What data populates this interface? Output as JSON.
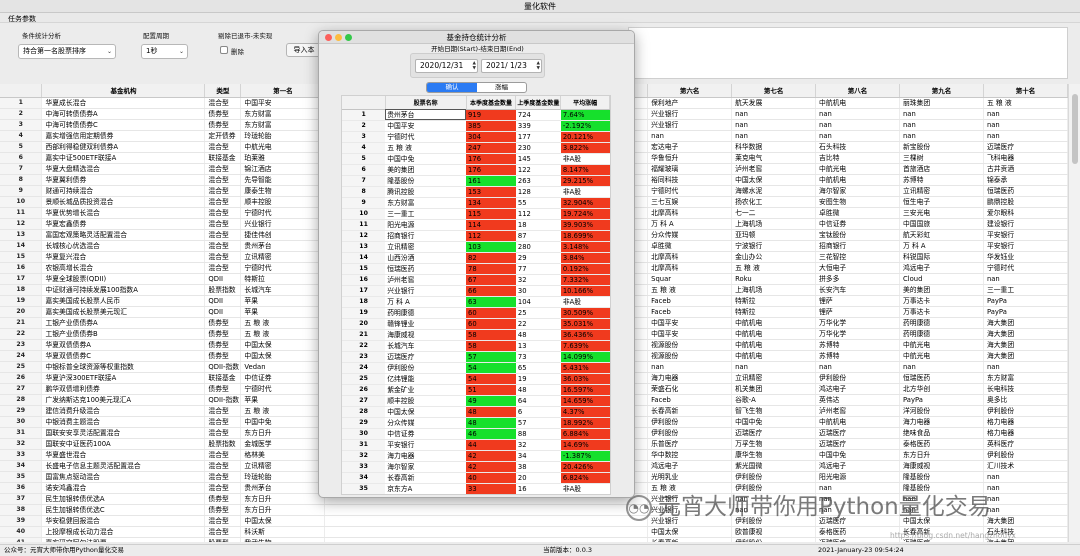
{
  "app": {
    "title": "量化软件",
    "tab": "任务参数"
  },
  "toolbar": {
    "filter_label": "条件统计分析",
    "filter_value": "持合第一名股票排序",
    "period_label": "配置周期",
    "period_value": "1秒",
    "delisted_label": "剔除已退市-未实现",
    "delete_label": "删除",
    "import_label": "导入本"
  },
  "grid": {
    "headers": [
      "基金机构",
      "类型",
      "第一名",
      "第六名",
      "第七名",
      "第八名",
      "第九名",
      "第十名"
    ],
    "rows": [
      [
        "华夏成长混合",
        "混合型",
        "中国平安",
        "保利地产",
        "航天发展",
        "中航机电",
        "丽珠集团",
        "五 粮 液"
      ],
      [
        "中海可转债债券A",
        "债券型",
        "东方财富",
        "兴业银行",
        "nan",
        "nan",
        "nan",
        "nan"
      ],
      [
        "中海可转债债券C",
        "债券型",
        "东方财富",
        "兴业银行",
        "nan",
        "nan",
        "nan",
        "nan"
      ],
      [
        "嘉实增强信用定期债券",
        "定开债券",
        "玲珑轮胎",
        "nan",
        "nan",
        "nan",
        "nan",
        "nan"
      ],
      [
        "西部利得稳健双利债券A",
        "混合型",
        "中航光电",
        "宏达电子",
        "科华数据",
        "石头科技",
        "新宝股份",
        "迈瑞医疗"
      ],
      [
        "嘉实中证500ETF联接A",
        "联接基金",
        "珀莱雅",
        "华鲁恒升",
        "莱克电气",
        "吉比特",
        "三棵树",
        "飞科电器"
      ],
      [
        "华夏大盘精选混合",
        "混合型",
        "锦江酒店",
        "福耀玻璃",
        "泸州老窖",
        "中航光电",
        "首旅酒店",
        "古井贡酒"
      ],
      [
        "华夏翼利债券",
        "混合型",
        "先导智能",
        "裕同科技",
        "中国太保",
        "中航机电",
        "苏博特",
        "锦泰承"
      ],
      [
        "财通可持续混合",
        "混合型",
        "康泰生物",
        "宁德时代",
        "海螺水泥",
        "海尔智家",
        "立讯精密",
        "恒瑞医药"
      ],
      [
        "景顺长城品质投资混合",
        "混合型",
        "顺丰控股",
        "三七互娱",
        "扬农化工",
        "安图生物",
        "恒生电子",
        "鹏鼎控股"
      ],
      [
        "华夏优势增长混合",
        "混合型",
        "宁德时代",
        "北摩高科",
        "七一二",
        "卓胜微",
        "三安光电",
        "爱尔眼科"
      ],
      [
        "华夏宏鑫债券",
        "混合型",
        "兴业银行",
        "万 科 A",
        "上海机场",
        "中信证券",
        "中国国旅",
        "建设银行"
      ],
      [
        "富国宏观策略灵活配置混合",
        "混合型",
        "捷佳伟创",
        "分众传媒",
        "亚玛顿",
        "宝钛股份",
        "航天彩虹",
        "平安银行"
      ],
      [
        "长城核心优选混合",
        "混合型",
        "贵州茅台",
        "卓胜微",
        "宁波银行",
        "招商银行",
        "万 科 A",
        "平安银行"
      ],
      [
        "华夏复兴混合",
        "混合型",
        "立讯精密",
        "北摩高科",
        "金山办公",
        "三花智控",
        "科锐国际",
        "华发钰业"
      ],
      [
        "农银高增长混合",
        "混合型",
        "宁德时代",
        "北摩高科",
        "五 粮 液",
        "大恒电子",
        "鸿远电子",
        "宁德时代"
      ],
      [
        "华夏全球股票(QDII)",
        "QDII",
        "特斯拉",
        "Squar",
        "Roku",
        "拼多多",
        "Cloud",
        "nan"
      ],
      [
        "中证财通可持续发展100指数A",
        "股票指数",
        "长城汽车",
        "五 粮 液",
        "上海机场",
        "长安汽车",
        "美的集团",
        "三一重工"
      ],
      [
        "嘉实美国成长股票人民币",
        "QDII",
        "苹果",
        "Faceb",
        "特斯拉",
        "锂萨",
        "万事达卡",
        "PayPa"
      ],
      [
        "嘉实美国成长股票美元现汇",
        "QDII",
        "苹果",
        "Faceb",
        "特斯拉",
        "锂萨",
        "万事达卡",
        "PayPa"
      ],
      [
        "工银产业债债券A",
        "债券型",
        "五 粮 液",
        "中国平安",
        "中航机电",
        "万华化学",
        "药明康德",
        "海大集团"
      ],
      [
        "工银产业债债券B",
        "债券型",
        "五 粮 液",
        "中国平安",
        "中航机电",
        "万华化学",
        "药明康德",
        "海大集团"
      ],
      [
        "华夏双债债券A",
        "债券型",
        "中国太保",
        "视源股份",
        "中航机电",
        "苏博特",
        "中航光电",
        "海大集团"
      ],
      [
        "华夏双债债券C",
        "债券型",
        "中国太保",
        "视源股份",
        "中航机电",
        "苏博特",
        "中航光电",
        "海大集团"
      ],
      [
        "中银标普全球资源等权重指数",
        "QDII-指数",
        "Vedan",
        "nan",
        "nan",
        "nan",
        "nan",
        "nan"
      ],
      [
        "华夏沪深300ETF联接A",
        "联接基金",
        "中信证券",
        "海力电器",
        "立讯精密",
        "伊利股份",
        "恒瑞医药",
        "东方财富"
      ],
      [
        "鹏华双债增利债券",
        "债券型",
        "宁德时代",
        "荣盛石化",
        "机关集团",
        "鸿达电子",
        "北方华创",
        "长电科技"
      ],
      [
        "广发纳斯达克100美元现汇A",
        "QDII-指数",
        "苹果",
        "Faceb",
        "谷歌-A",
        "英伟达",
        "PayPa",
        "奥多比"
      ],
      [
        "建信消费升级混合",
        "混合型",
        "五 粮 液",
        "长春高新",
        "智飞生物",
        "泸州老窖",
        "洋河股份",
        "伊利股份"
      ],
      [
        "中银消费主题混合",
        "混合型",
        "中国中免",
        "伊利股份",
        "中国中免",
        "中航机电",
        "海力电器",
        "格力电器"
      ],
      [
        "国联安安享灵活配置混合",
        "混合型",
        "东方日升",
        "伊利股份",
        "迈瑞医疗",
        "迈瑞医疗",
        "绝味食品",
        "格力电器"
      ],
      [
        "国联安中证医药100A",
        "股票指数",
        "金城医学",
        "乐普医疗",
        "万孚生物",
        "迈瑞医疗",
        "泰格医药",
        "英科医疗"
      ],
      [
        "华夏盛世混合",
        "混合型",
        "格林美",
        "华中数控",
        "康华生物",
        "中国中免",
        "东方日升",
        "伊利股份"
      ],
      [
        "长盛电子信息主题灵活配置混合",
        "混合型",
        "立讯精密",
        "鸿远电子",
        "紫光国微",
        "鸿远电子",
        "海康威视",
        "汇川技术"
      ],
      [
        "国富焦点驱动混合",
        "混合型",
        "玲珑轮胎",
        "光明乳业",
        "伊利股份",
        "阳光电源",
        "隆基股份",
        "nan"
      ],
      [
        "诺安鸿鑫混合",
        "混合型",
        "贵州茅台",
        "五 粮 液",
        "伊利股份",
        "nan",
        "隆基股份",
        "nan"
      ],
      [
        "民生加银转债优选A",
        "债券型",
        "东方日升",
        "兴业银行",
        "nan",
        "nan",
        "nan",
        "nan"
      ],
      [
        "民生加银转债优选C",
        "债券型",
        "东方日升",
        "兴业银行",
        "nan",
        "nan",
        "nan",
        "nan"
      ],
      [
        "华安稳健回报混合",
        "混合型",
        "中国太保",
        "兴业银行",
        "伊利股份",
        "迈瑞医疗",
        "中国太保",
        "海大集团"
      ],
      [
        "上投摩根成长动力混合",
        "混合型",
        "科沃斯",
        "中国太保",
        "欧普康视",
        "泰格医药",
        "长春高新",
        "石头科技"
      ],
      [
        "嘉实研究阿尔法股票",
        "股票型",
        "我武生物",
        "长春高新",
        "伊利股份",
        "迈瑞医疗",
        "迈瑞医疗",
        "海大集团"
      ],
      [
        "长信利丰债券",
        "债券型",
        "中国平安",
        "五 粮 液",
        "酒鬼酒",
        "中航光电",
        "新希望",
        "九阳股份"
      ]
    ]
  },
  "dialog": {
    "title": "基金持仓统计分析",
    "range_label": "开始日期(Start)-结束日期(End)",
    "start_date": "2020/12/31",
    "end_date": "2021/ 1/23",
    "confirm_label": "确认",
    "sort_label": "涨幅",
    "headers": [
      "股票名称",
      "本季度基金数量",
      "上季度基金数量",
      "平均涨幅"
    ],
    "rows": [
      [
        "贵州茅台",
        "919",
        "724",
        "7.64%"
      ],
      [
        "中国平安",
        "385",
        "339",
        "-2.192%"
      ],
      [
        "宁德时代",
        "304",
        "177",
        "20.121%"
      ],
      [
        "五 粮 液",
        "247",
        "230",
        "3.822%"
      ],
      [
        "中国中免",
        "176",
        "145",
        "非A股"
      ],
      [
        "美的集团",
        "176",
        "122",
        "8.147%"
      ],
      [
        "隆基股份",
        "161",
        "263",
        "29.215%"
      ],
      [
        "腾讯控股",
        "153",
        "128",
        "非A股"
      ],
      [
        "东方财富",
        "134",
        "55",
        "32.904%"
      ],
      [
        "三一重工",
        "115",
        "112",
        "19.724%"
      ],
      [
        "阳光电源",
        "114",
        "18",
        "39.903%"
      ],
      [
        "招商银行",
        "112",
        "87",
        "18.699%"
      ],
      [
        "立讯精密",
        "103",
        "280",
        "3.148%"
      ],
      [
        "山西汾酒",
        "82",
        "29",
        "3.84%"
      ],
      [
        "恒瑞医药",
        "78",
        "77",
        "0.192%"
      ],
      [
        "泸州老窖",
        "67",
        "32",
        "7.332%"
      ],
      [
        "兴业银行",
        "66",
        "30",
        "10.166%"
      ],
      [
        "万 科 A",
        "63",
        "104",
        "非A股"
      ],
      [
        "药明康德",
        "60",
        "25",
        "30.509%"
      ],
      [
        "赣锋锂业",
        "60",
        "22",
        "35.031%"
      ],
      [
        "海康威视",
        "58",
        "48",
        "36.436%"
      ],
      [
        "长城汽车",
        "58",
        "13",
        "7.639%"
      ],
      [
        "迈瑞医疗",
        "57",
        "73",
        "14.099%"
      ],
      [
        "伊利股份",
        "54",
        "65",
        "5.431%"
      ],
      [
        "亿纬锂能",
        "54",
        "19",
        "36.03%"
      ],
      [
        "紫金矿业",
        "51",
        "48",
        "16.597%"
      ],
      [
        "顺丰控股",
        "49",
        "64",
        "14.659%"
      ],
      [
        "中国太保",
        "48",
        "6",
        "4.37%"
      ],
      [
        "分众传媒",
        "48",
        "57",
        "18.992%"
      ],
      [
        "中信证券",
        "46",
        "88",
        "6.884%"
      ],
      [
        "平安银行",
        "44",
        "32",
        "14.69%"
      ],
      [
        "海力电器",
        "42",
        "34",
        "-1.387%"
      ],
      [
        "海尔智家",
        "42",
        "38",
        "20.426%"
      ],
      [
        "长春高新",
        "40",
        "20",
        "6.824%"
      ],
      [
        "京东方A",
        "33",
        "16",
        "非A股"
      ],
      [
        "华鲁恒升",
        "31",
        "47",
        "29.03%"
      ]
    ],
    "cur_colors": [
      "red",
      "red",
      "red",
      "red",
      "red",
      "red",
      "green",
      "red",
      "red",
      "red",
      "red",
      "red",
      "green",
      "red",
      "red",
      "red",
      "red",
      "green",
      "red",
      "red",
      "red",
      "red",
      "green",
      "green",
      "red",
      "red",
      "green",
      "red",
      "green",
      "green",
      "red",
      "red",
      "red",
      "red",
      "red",
      "green"
    ],
    "chg_colors": [
      "green",
      "green",
      "red",
      "red",
      "none",
      "red",
      "red",
      "none",
      "red",
      "red",
      "red",
      "red",
      "red",
      "red",
      "red",
      "red",
      "red",
      "none",
      "red",
      "red",
      "red",
      "red",
      "green",
      "red",
      "red",
      "red",
      "red",
      "red",
      "red",
      "red",
      "red",
      "green",
      "red",
      "red",
      "none",
      "red"
    ]
  },
  "colors": {
    "red": "#f03a1e",
    "green": "#16e02c"
  },
  "status": {
    "left": "公众号：元宵大师带你用Python量化交易",
    "version": "当前版本：0.0.3",
    "time": "2021-January-23 09:54:24"
  },
  "watermark": "元宵大师带你用Python量化交易",
  "watermark_url": "https://blog.csdn.net/hangzhouyx"
}
